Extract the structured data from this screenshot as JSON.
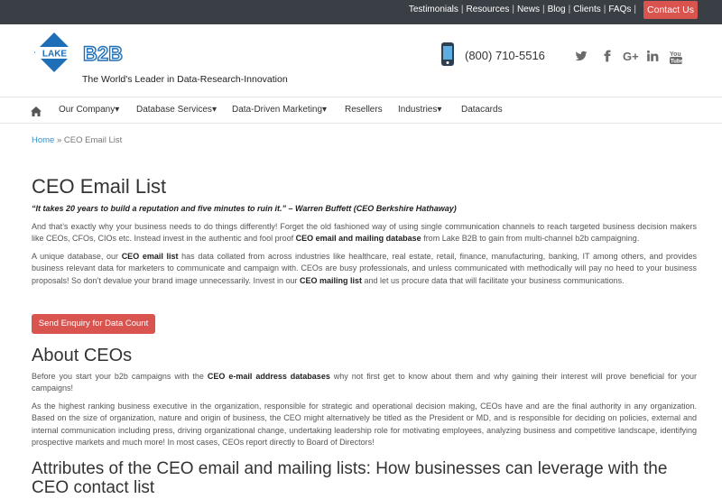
{
  "topbar": {
    "links": [
      "Testimonials",
      "Resources",
      "News",
      "Blog",
      "Clients",
      "FAQs"
    ],
    "contact_label": "Contact Us"
  },
  "header": {
    "logo_text": "LAKE B2B",
    "tagline": "The World's Leader in Data-Research-Innovation",
    "phone": "(800) 710-5516",
    "social_icons": [
      "twitter-icon",
      "facebook-icon",
      "google-plus-icon",
      "linkedin-icon",
      "youtube-icon"
    ]
  },
  "nav": {
    "items": [
      "Our Company",
      "Database Services",
      "Data-Driven Marketing",
      "Resellers",
      "Industries",
      "Datacards"
    ]
  },
  "breadcrumb": {
    "home": "Home",
    "sep": " » ",
    "current": "CEO Email List"
  },
  "main": {
    "title": "CEO Email List",
    "quote": "“It takes 20 years to build a reputation and five minutes to ruin it.” – Warren Buffett (CEO Berkshire Hathaway)",
    "p1": {
      "a": "And that’s exactly why your business needs to do things differently! Forget the old fashioned way of using single communication channels to reach targeted business decision makers like CEOs, CFOs, CIOs etc. Instead invest in the authentic and fool proof ",
      "b": "CEO email and mailing database",
      "c": " from Lake B2B to gain from multi-channel b2b campaigning."
    },
    "p2": {
      "a": "A unique database, our ",
      "b": "CEO email list",
      "c": " has data collated from across industries like healthcare, real estate, retail, finance, manufacturing, banking, IT among others, and provides business relevant data for marketers to communicate and campaign with. CEOs are busy professionals, and unless communicated with methodically will pay no heed to your business proposals! So don’t devalue your brand image unnecessarily. Invest in our ",
      "d": "CEO mailing list",
      "e": " and let us procure data that will facilitate your business communications."
    },
    "enquiry_label": "Send Enquiry for Data Count",
    "about_title": "About CEOs",
    "p3": {
      "a": "Before you start your b2b campaigns with the ",
      "b": "CEO e-mail address databases",
      "c": " why not first get to know about them and why gaining their interest will prove beneficial for your campaigns!"
    },
    "p4": "As the highest ranking business executive in the organization, responsible for strategic and operational decision making, CEOs have and are the final authority in any organization. Based on the size of organization, nature and origin of business, the CEO might alternatively be titled as the President or MD, and is responsible for deciding on policies, external and internal communication including press, driving organizational change, undertaking leadership role for motivating employees, analyzing business and competitive landscape, identifying prospective markets and much more! In most cases, CEOs report directly to Board of Directors!",
    "attr_title": "Attributes of the CEO email and mailing lists: How businesses can leverage with the CEO contact list"
  },
  "colors": {
    "accent_red": "#d9534f",
    "link_blue": "#3a8fc8",
    "topbar_bg": "#3a3f45"
  }
}
